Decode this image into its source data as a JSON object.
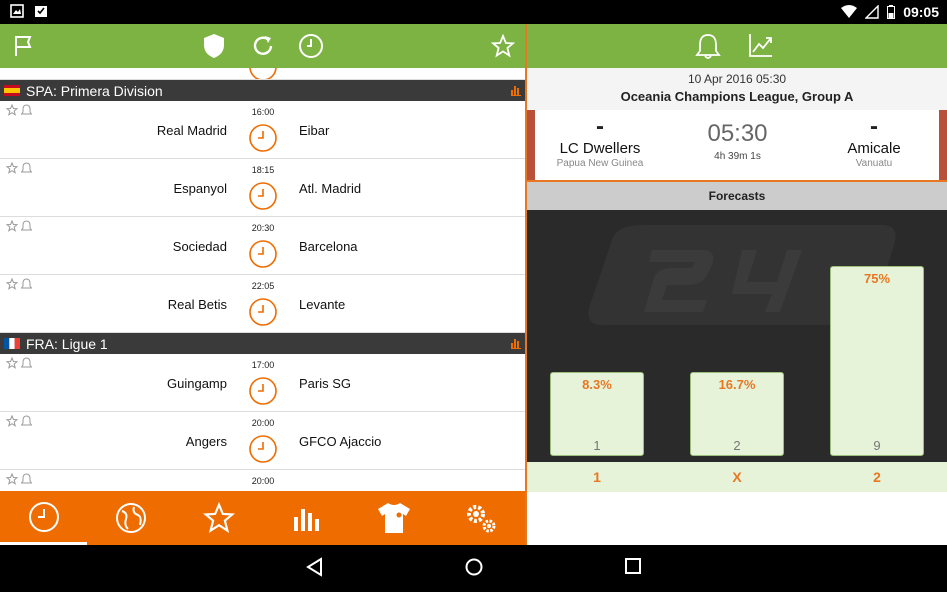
{
  "status": {
    "time": "09:05"
  },
  "leagues": [
    {
      "name": "SPA: Primera Division",
      "flag": "spain",
      "matches": [
        {
          "time": "16:00",
          "home": "Real Madrid",
          "away": "Eibar"
        },
        {
          "time": "18:15",
          "home": "Espanyol",
          "away": "Atl. Madrid"
        },
        {
          "time": "20:30",
          "home": "Sociedad",
          "away": "Barcelona"
        },
        {
          "time": "22:05",
          "home": "Real Betis",
          "away": "Levante"
        }
      ]
    },
    {
      "name": "FRA: Ligue 1",
      "flag": "france",
      "matches": [
        {
          "time": "17:00",
          "home": "Guingamp",
          "away": "Paris SG"
        },
        {
          "time": "20:00",
          "home": "Angers",
          "away": "GFCO Ajaccio"
        },
        {
          "time": "20:00",
          "home": "",
          "away": ""
        }
      ]
    }
  ],
  "detail": {
    "date": "10 Apr 2016 05:30",
    "competition": "Oceania Champions League, Group A",
    "home": {
      "score": "-",
      "name": "LC Dwellers",
      "country": "Papua New Guinea"
    },
    "away": {
      "score": "-",
      "name": "Amicale",
      "country": "Vanuatu"
    },
    "kickoff": "05:30",
    "countdown": "4h 39m 1s"
  },
  "forecasts": {
    "title": "Forecasts",
    "items": [
      {
        "label": "1",
        "percent": 8.3,
        "percent_text": "8.3%",
        "count": "1"
      },
      {
        "label": "X",
        "percent": 16.7,
        "percent_text": "16.7%",
        "count": "2"
      },
      {
        "label": "2",
        "percent": 75,
        "percent_text": "75%",
        "count": "9"
      }
    ]
  },
  "colors": {
    "green": "#7cb342",
    "orange": "#ef6c00"
  }
}
